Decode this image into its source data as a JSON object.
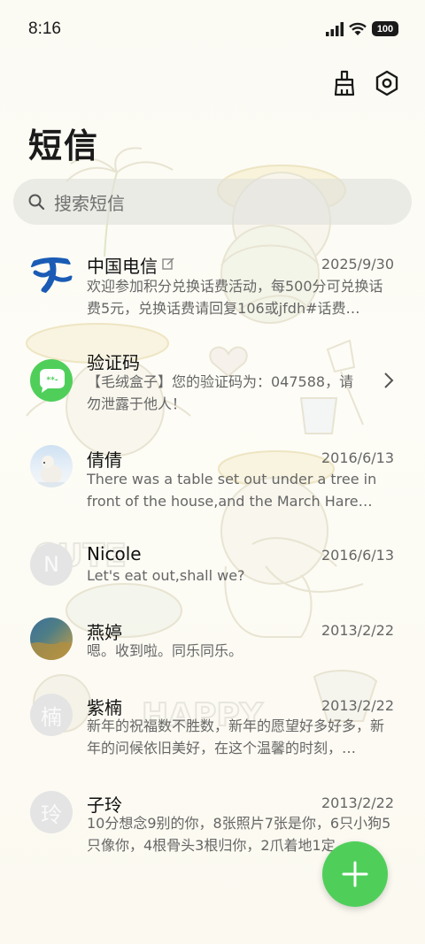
{
  "status_bar": {
    "time": "8:16",
    "battery": "100"
  },
  "header": {
    "title": "短信"
  },
  "search": {
    "placeholder": "搜索短信"
  },
  "conversations": [
    {
      "name": "中国电信",
      "date": "2025/9/30",
      "preview": "欢迎参加积分兑换话费活动，每500分可兑换话费5元，兑换话费请回复106或jfdh#话费…",
      "avatar": "china-telecom-logo"
    },
    {
      "name": "验证码",
      "date": "",
      "preview": "【毛绒盒子】您的验证码为：047588，请勿泄露于他人！",
      "avatar": "message-bubble-icon"
    },
    {
      "name": "倩倩",
      "date": "2016/6/13",
      "preview": "There was a table set out under a tree in front of the house,and the March Hare an…",
      "avatar": "polar-bear-photo"
    },
    {
      "name": "Nicole",
      "date": "2016/6/13",
      "preview": "Let's eat out,shall we?",
      "avatar_letter": "N"
    },
    {
      "name": "燕婷",
      "date": "2013/2/22",
      "preview": "嗯。收到啦。同乐同乐。",
      "avatar": "landscape-photo"
    },
    {
      "name": "紫楠",
      "date": "2013/2/22",
      "preview": "新年的祝福数不胜数，新年的愿望好多好多，新年的问候依旧美好，在这个温馨的时刻，…",
      "avatar_letter": "楠"
    },
    {
      "name": "子玲",
      "date": "2013/2/22",
      "preview": "10分想念9别的你，8张照片7张是你，6只小狗5只像你，4根骨头3根归你，2爪着地1定…",
      "avatar_letter": "玲"
    }
  ],
  "colors": {
    "accent": "#4fcf5a",
    "telecom_blue": "#1a5bb5"
  }
}
